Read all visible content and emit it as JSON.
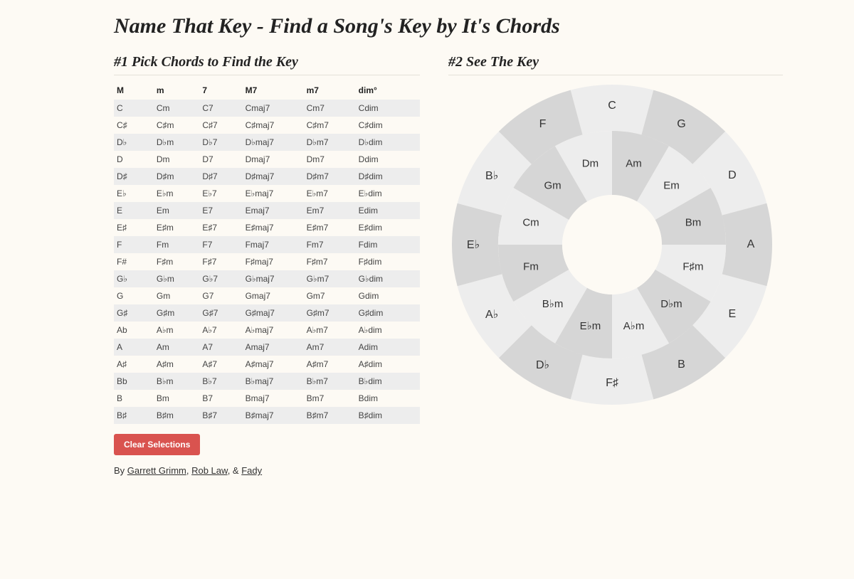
{
  "page_title": "Name That Key - Find a Song's Key by It's Chords",
  "left": {
    "heading": "#1 Pick Chords to Find the Key",
    "columns": [
      "M",
      "m",
      "7",
      "M7",
      "m7",
      "dim°"
    ],
    "rows": [
      [
        "C",
        "Cm",
        "C7",
        "Cmaj7",
        "Cm7",
        "Cdim"
      ],
      [
        "C♯",
        "C♯m",
        "C♯7",
        "C♯maj7",
        "C♯m7",
        "C♯dim"
      ],
      [
        "D♭",
        "D♭m",
        "D♭7",
        "D♭maj7",
        "D♭m7",
        "D♭dim"
      ],
      [
        "D",
        "Dm",
        "D7",
        "Dmaj7",
        "Dm7",
        "Ddim"
      ],
      [
        "D♯",
        "D♯m",
        "D♯7",
        "D♯maj7",
        "D♯m7",
        "D♯dim"
      ],
      [
        "E♭",
        "E♭m",
        "E♭7",
        "E♭maj7",
        "E♭m7",
        "E♭dim"
      ],
      [
        "E",
        "Em",
        "E7",
        "Emaj7",
        "Em7",
        "Edim"
      ],
      [
        "E♯",
        "E♯m",
        "E♯7",
        "E♯maj7",
        "E♯m7",
        "E♯dim"
      ],
      [
        "F",
        "Fm",
        "F7",
        "Fmaj7",
        "Fm7",
        "Fdim"
      ],
      [
        "F#",
        "F♯m",
        "F♯7",
        "F♯maj7",
        "F♯m7",
        "F♯dim"
      ],
      [
        "G♭",
        "G♭m",
        "G♭7",
        "G♭maj7",
        "G♭m7",
        "G♭dim"
      ],
      [
        "G",
        "Gm",
        "G7",
        "Gmaj7",
        "Gm7",
        "Gdim"
      ],
      [
        "G♯",
        "G♯m",
        "G♯7",
        "G♯maj7",
        "G♯m7",
        "G♯dim"
      ],
      [
        "Ab",
        "A♭m",
        "A♭7",
        "A♭maj7",
        "A♭m7",
        "A♭dim"
      ],
      [
        "A",
        "Am",
        "A7",
        "Amaj7",
        "Am7",
        "Adim"
      ],
      [
        "A♯",
        "A♯m",
        "A♯7",
        "A♯maj7",
        "A♯m7",
        "A♯dim"
      ],
      [
        "Bb",
        "B♭m",
        "B♭7",
        "B♭maj7",
        "B♭m7",
        "B♭dim"
      ],
      [
        "B",
        "Bm",
        "B7",
        "Bmaj7",
        "Bm7",
        "Bdim"
      ],
      [
        "B♯",
        "B♯m",
        "B♯7",
        "B♯maj7",
        "B♯m7",
        "B♯dim"
      ]
    ],
    "clear_label": "Clear Selections",
    "byline_prefix": "By ",
    "byline_authors": [
      "Garrett Grimm",
      "Rob Law",
      "Fady"
    ],
    "byline_sep": ", ",
    "byline_amp": ", & "
  },
  "right": {
    "heading": "#2 See The Key",
    "outer_majors": [
      "C",
      "G",
      "D",
      "A",
      "E",
      "B",
      "F♯",
      "D♭",
      "A♭",
      "E♭",
      "B♭",
      "F"
    ],
    "inner_minors": [
      "Am",
      "Em",
      "Bm",
      "F♯m",
      "D♭m",
      "A♭m",
      "E♭m",
      "B♭m",
      "Fm",
      "Cm",
      "Gm",
      "Dm"
    ]
  }
}
